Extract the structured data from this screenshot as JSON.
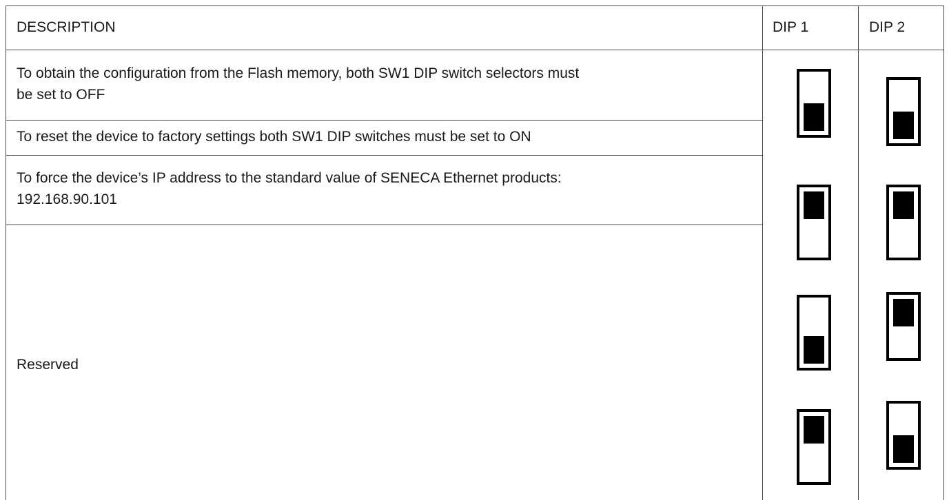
{
  "table": {
    "headers": {
      "description": "DESCRIPTION",
      "dip1": "DIP 1",
      "dip2": "DIP 2"
    },
    "rows": [
      {
        "description_line1": "To obtain the configuration from the Flash memory, both SW1 DIP switch selectors must",
        "description_line2": "be set to OFF",
        "dip1": "OFF",
        "dip2": "OFF"
      },
      {
        "description_line1": "To reset the device to factory settings both SW1 DIP switches must be set to ON",
        "dip1": "ON",
        "dip2": "ON"
      },
      {
        "description_line1": "To force the device’s IP address to the standard value of SENECA Ethernet products:",
        "description_line2": "192.168.90.101",
        "dip1": "OFF",
        "dip2": "ON"
      },
      {
        "description_line1": "Reserved",
        "dip1": "ON",
        "dip2": "OFF"
      }
    ]
  },
  "colors": {
    "border": "#444444",
    "switch": "#000000",
    "text": "#1a1a1a"
  }
}
